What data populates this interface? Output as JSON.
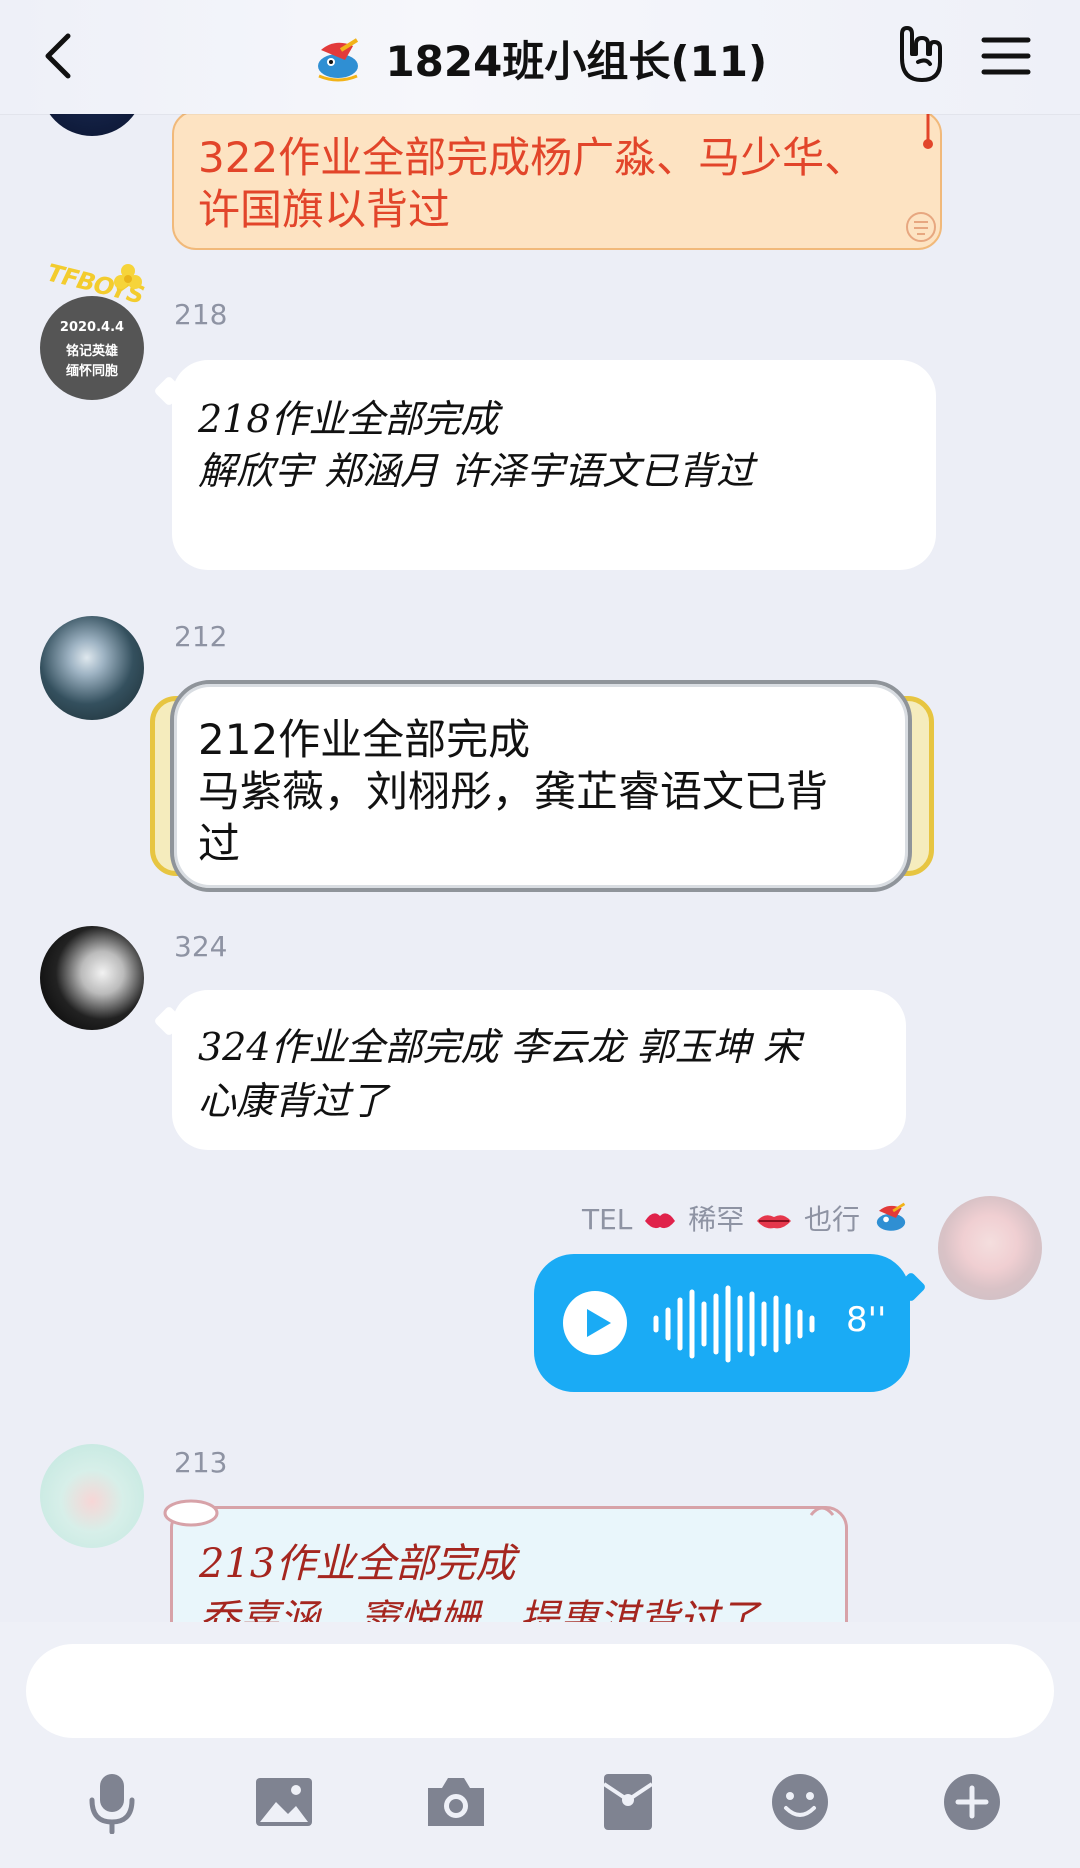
{
  "header": {
    "title": "1824班小组长(11)"
  },
  "messages": [
    {
      "id": "m322",
      "text_line1": "322作业全部完成杨广淼、马少华、",
      "text_line2": "许国旗以背过"
    },
    {
      "id": "m218",
      "sender": "218",
      "avatar_line1": "2020.4.4",
      "avatar_line2": "铭记英雄",
      "avatar_line3": "缅怀同胞",
      "avatar_badge": "TFBOYS",
      "text_line1": "218作业全部完成",
      "text_line2": "解欣宇 郑涵月 许泽宇语文已背过"
    },
    {
      "id": "m212",
      "sender": "212",
      "text_line1": "212作业全部完成",
      "text_line2": "马紫薇，刘栩彤，龚芷睿语文已背",
      "text_line3": "过"
    },
    {
      "id": "m324",
      "sender": "324",
      "text_line1": "324作业全部完成 李云龙 郭玉坤 宋",
      "text_line2": "心康背过了"
    },
    {
      "id": "mTEL",
      "sender_prefix": "TEL",
      "sender_mid": "稀罕",
      "sender_suffix": "也行",
      "voice_duration": "8''"
    },
    {
      "id": "m213",
      "sender": "213",
      "text_line1": "213作业全部完成",
      "text_line2": "乔嘉涵，窦悦姗，提惠淇背过了"
    }
  ],
  "colors": {
    "background": "#eceef6",
    "voice_bubble": "#1aabf5",
    "m322_text": "#e2452a",
    "m213_text": "#a5261f"
  }
}
